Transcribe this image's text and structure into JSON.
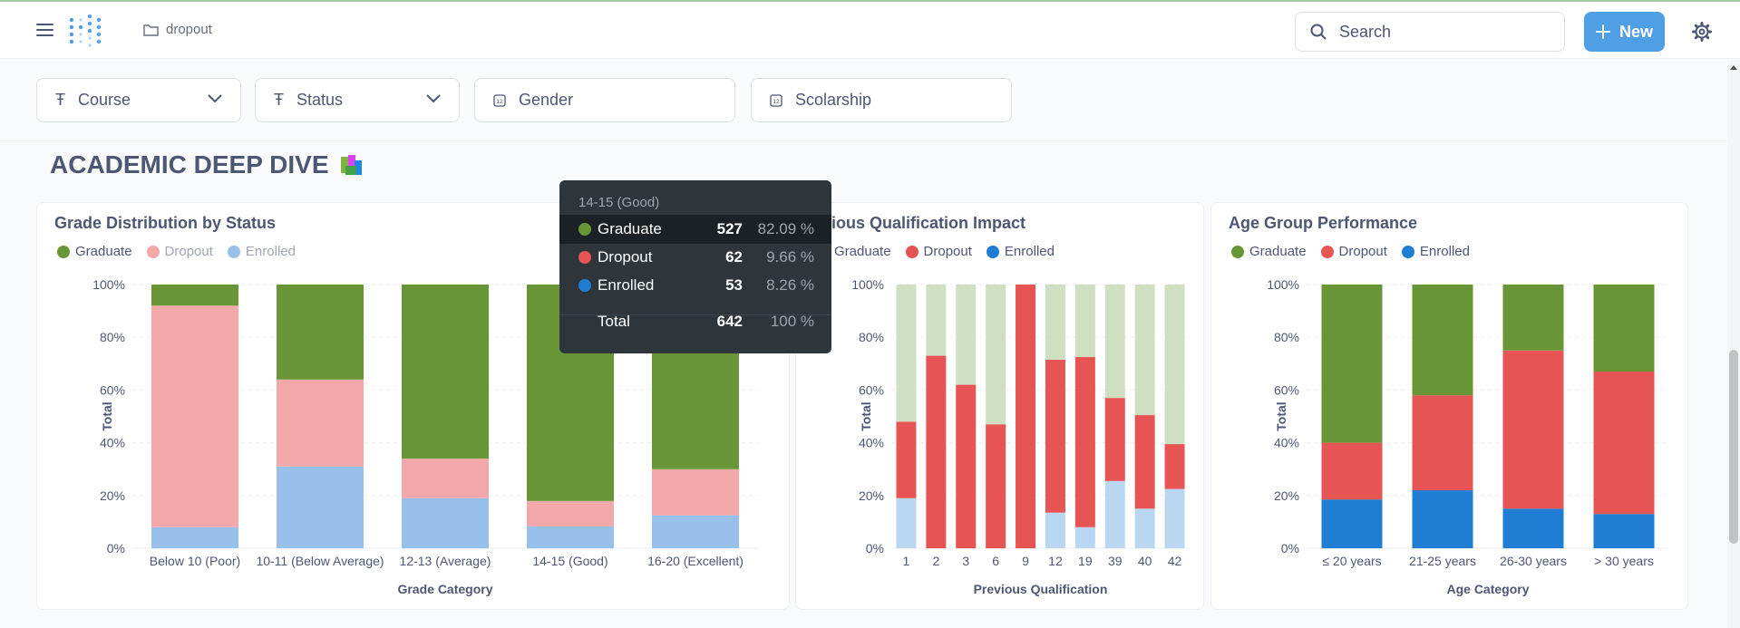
{
  "topbar": {
    "breadcrumb": "dropout",
    "search_placeholder": "Search",
    "new_label": "New"
  },
  "filters": [
    {
      "label": "Course",
      "type": "text"
    },
    {
      "label": "Status",
      "type": "text"
    },
    {
      "label": "Gender",
      "type": "number"
    },
    {
      "label": "Scolarship",
      "type": "number"
    }
  ],
  "section_title": "ACADEMIC DEEP DIVE",
  "colors": {
    "graduate": "#689636",
    "dropout": "#e75454",
    "enrolled": "#1f7ed3",
    "graduate_faded": "#cfdfc1",
    "dropout_faded": "#f3a9a9",
    "enrolled_faded": "#97c0eb",
    "brand_blue": "#509ee3"
  },
  "cards": {
    "grade": {
      "title": "Grade Distribution by Status"
    },
    "prev": {
      "title": "Previous Qualification Impact",
      "title_visible": "evious Qualification Impact"
    },
    "age": {
      "title": "Age Group Performance"
    }
  },
  "chart_data": [
    {
      "type": "bar",
      "stacked": "percent",
      "title": "Grade Distribution by Status",
      "xlabel": "Grade Category",
      "ylabel": "Total",
      "ylim": [
        0,
        100
      ],
      "yticks": [
        "0%",
        "20%",
        "40%",
        "60%",
        "80%",
        "100%"
      ],
      "categories": [
        "Below 10 (Poor)",
        "10-11 (Below Average)",
        "12-13 (Average)",
        "14-15 (Good)",
        "16-20 (Excellent)"
      ],
      "series": [
        {
          "name": "Enrolled",
          "values": [
            8,
            31,
            19,
            8.26,
            12.5
          ]
        },
        {
          "name": "Dropout",
          "values": [
            84,
            33,
            15,
            9.66,
            17.5
          ]
        },
        {
          "name": "Graduate",
          "values": [
            8,
            36,
            66,
            82.09,
            70
          ]
        }
      ],
      "legend": [
        "Graduate",
        "Dropout",
        "Enrolled"
      ],
      "highlighted_category": "14-15 (Good)"
    },
    {
      "type": "bar",
      "stacked": "percent",
      "title": "Previous Qualification Impact",
      "xlabel": "Previous Qualification",
      "ylabel": "Total",
      "ylim": [
        0,
        100
      ],
      "yticks": [
        "0%",
        "20%",
        "40%",
        "60%",
        "80%",
        "100%"
      ],
      "categories": [
        "1",
        "2",
        "3",
        "6",
        "9",
        "12",
        "19",
        "39",
        "40",
        "42"
      ],
      "series": [
        {
          "name": "Enrolled",
          "values": [
            19,
            0,
            0,
            0,
            0,
            13.5,
            8,
            25.5,
            15,
            22.5
          ]
        },
        {
          "name": "Dropout",
          "values": [
            29,
            73,
            62,
            47,
            100,
            58,
            64.5,
            31.5,
            35.5,
            17
          ]
        },
        {
          "name": "Graduate",
          "values": [
            52,
            27,
            38,
            53,
            0,
            28.5,
            27.5,
            43,
            49.5,
            60.5
          ]
        }
      ],
      "legend": [
        "Graduate",
        "Dropout",
        "Enrolled"
      ]
    },
    {
      "type": "bar",
      "stacked": "percent",
      "title": "Age Group Performance",
      "xlabel": "Age Category",
      "ylabel": "Total",
      "ylim": [
        0,
        100
      ],
      "yticks": [
        "0%",
        "20%",
        "40%",
        "60%",
        "80%",
        "100%"
      ],
      "categories": [
        "≤ 20 years",
        "21-25 years",
        "26-30 years",
        "> 30 years"
      ],
      "series": [
        {
          "name": "Enrolled",
          "values": [
            18.5,
            22,
            15,
            13
          ]
        },
        {
          "name": "Dropout",
          "values": [
            21.5,
            36,
            60,
            54
          ]
        },
        {
          "name": "Graduate",
          "values": [
            60,
            42,
            25,
            33
          ]
        }
      ],
      "legend": [
        "Graduate",
        "Dropout",
        "Enrolled"
      ]
    }
  ],
  "tooltip": {
    "header": "14-15 (Good)",
    "rows": [
      {
        "label": "Graduate",
        "value": "527",
        "pct": "82.09 %"
      },
      {
        "label": "Dropout",
        "value": "62",
        "pct": "9.66 %"
      },
      {
        "label": "Enrolled",
        "value": "53",
        "pct": "8.26 %"
      }
    ],
    "total_label": "Total",
    "total_value": "642",
    "total_pct": "100 %"
  }
}
